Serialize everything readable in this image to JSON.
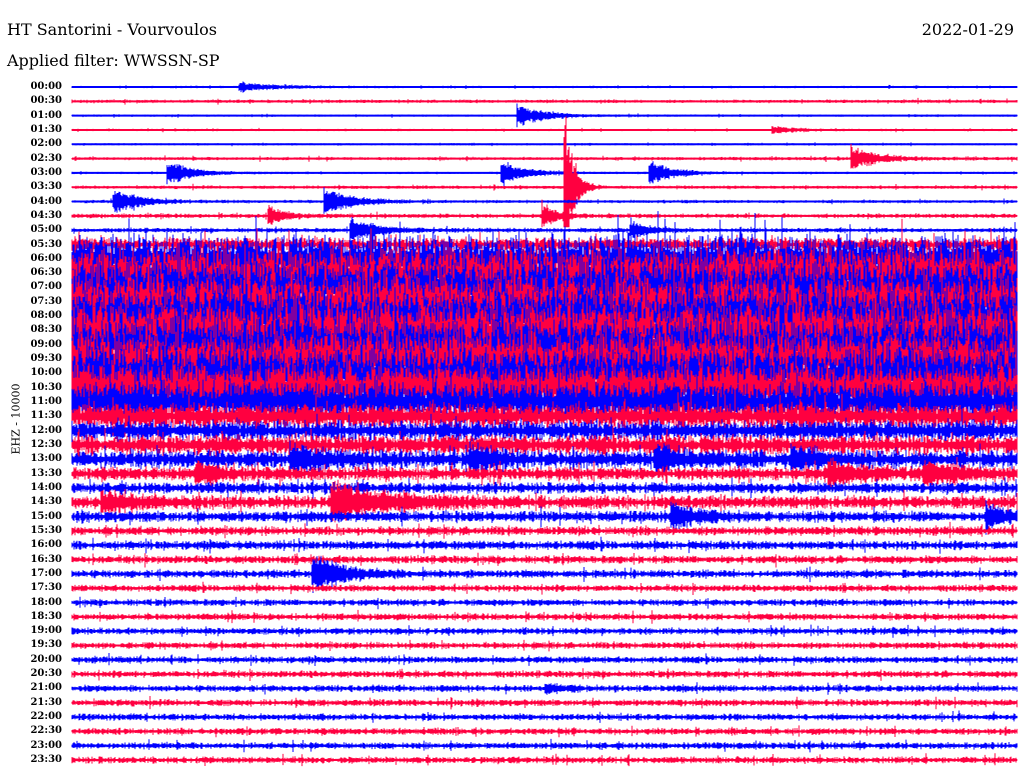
{
  "header": {
    "station": "HT Santorini - Vourvoulos",
    "date": "2022-01-29",
    "filter": "Applied filter: WWSSN-SP"
  },
  "chart_data": {
    "type": "line",
    "subtype": "helicorder",
    "ylabel": "EHZ - 10000",
    "x_range_minutes": [
      0,
      30
    ],
    "colors": [
      "#0000ff",
      "#ff0040"
    ],
    "row_labels": [
      "00:00",
      "00:30",
      "01:00",
      "01:30",
      "02:00",
      "02:30",
      "03:00",
      "03:30",
      "04:00",
      "04:30",
      "05:00",
      "05:30",
      "06:00",
      "06:30",
      "07:00",
      "07:30",
      "08:00",
      "08:30",
      "09:00",
      "09:30",
      "10:00",
      "10:30",
      "11:00",
      "11:30",
      "12:00",
      "12:30",
      "13:00",
      "13:30",
      "14:00",
      "14:30",
      "15:00",
      "15:30",
      "16:00",
      "16:30",
      "17:00",
      "17:30",
      "18:00",
      "18:30",
      "19:00",
      "19:30",
      "20:00",
      "20:30",
      "21:00",
      "21:30",
      "22:00",
      "22:30",
      "23:00",
      "23:30"
    ],
    "noise_level": [
      1,
      1.5,
      1,
      1,
      1,
      1.5,
      1,
      1.5,
      1.5,
      2,
      2,
      6,
      22,
      24,
      25,
      25,
      26,
      26,
      25,
      25,
      24,
      23,
      18,
      12,
      9,
      9,
      8,
      6,
      5,
      6,
      5,
      4,
      4,
      3.5,
      3.5,
      3,
      3,
      3,
      3,
      3,
      3,
      3,
      3,
      3,
      3,
      3,
      3,
      3
    ],
    "events": [
      {
        "row": 0,
        "minute": 5.3,
        "amp": 5,
        "decay": 1.2
      },
      {
        "row": 2,
        "minute": 14.1,
        "amp": 13,
        "decay": 0.8
      },
      {
        "row": 3,
        "minute": 22.2,
        "amp": 4,
        "decay": 0.8
      },
      {
        "row": 5,
        "minute": 24.7,
        "amp": 13,
        "decay": 0.8
      },
      {
        "row": 6,
        "minute": 3.0,
        "amp": 13,
        "decay": 0.8
      },
      {
        "row": 6,
        "minute": 13.6,
        "amp": 13,
        "decay": 0.8
      },
      {
        "row": 6,
        "minute": 18.3,
        "amp": 13,
        "decay": 0.8
      },
      {
        "row": 7,
        "minute": 15.6,
        "amp": 110,
        "decay": 0.25
      },
      {
        "row": 8,
        "minute": 1.3,
        "amp": 13,
        "decay": 0.8
      },
      {
        "row": 8,
        "minute": 8.0,
        "amp": 15,
        "decay": 0.8
      },
      {
        "row": 9,
        "minute": 6.2,
        "amp": 11,
        "decay": 0.5
      },
      {
        "row": 9,
        "minute": 14.9,
        "amp": 14,
        "decay": 0.4
      },
      {
        "row": 10,
        "minute": 8.8,
        "amp": 13,
        "decay": 0.8
      },
      {
        "row": 10,
        "minute": 17.7,
        "amp": 10,
        "decay": 0.6
      },
      {
        "row": 26,
        "minute": 6.9,
        "amp": 12,
        "decay": 0.8
      },
      {
        "row": 26,
        "minute": 12.6,
        "amp": 12,
        "decay": 0.8
      },
      {
        "row": 26,
        "minute": 18.5,
        "amp": 12,
        "decay": 0.8
      },
      {
        "row": 26,
        "minute": 22.8,
        "amp": 12,
        "decay": 0.8
      },
      {
        "row": 27,
        "minute": 3.9,
        "amp": 10,
        "decay": 0.8
      },
      {
        "row": 27,
        "minute": 24.0,
        "amp": 12,
        "decay": 1.0
      },
      {
        "row": 27,
        "minute": 27.0,
        "amp": 12,
        "decay": 1.0
      },
      {
        "row": 29,
        "minute": 0.9,
        "amp": 10,
        "decay": 1.0
      },
      {
        "row": 29,
        "minute": 8.2,
        "amp": 20,
        "decay": 1.5
      },
      {
        "row": 30,
        "minute": 19.0,
        "amp": 12,
        "decay": 0.8
      },
      {
        "row": 30,
        "minute": 29.0,
        "amp": 12,
        "decay": 0.6
      },
      {
        "row": 34,
        "minute": 7.6,
        "amp": 20,
        "decay": 1.0
      },
      {
        "row": 42,
        "minute": 15.0,
        "amp": 6,
        "decay": 0.5
      }
    ]
  }
}
